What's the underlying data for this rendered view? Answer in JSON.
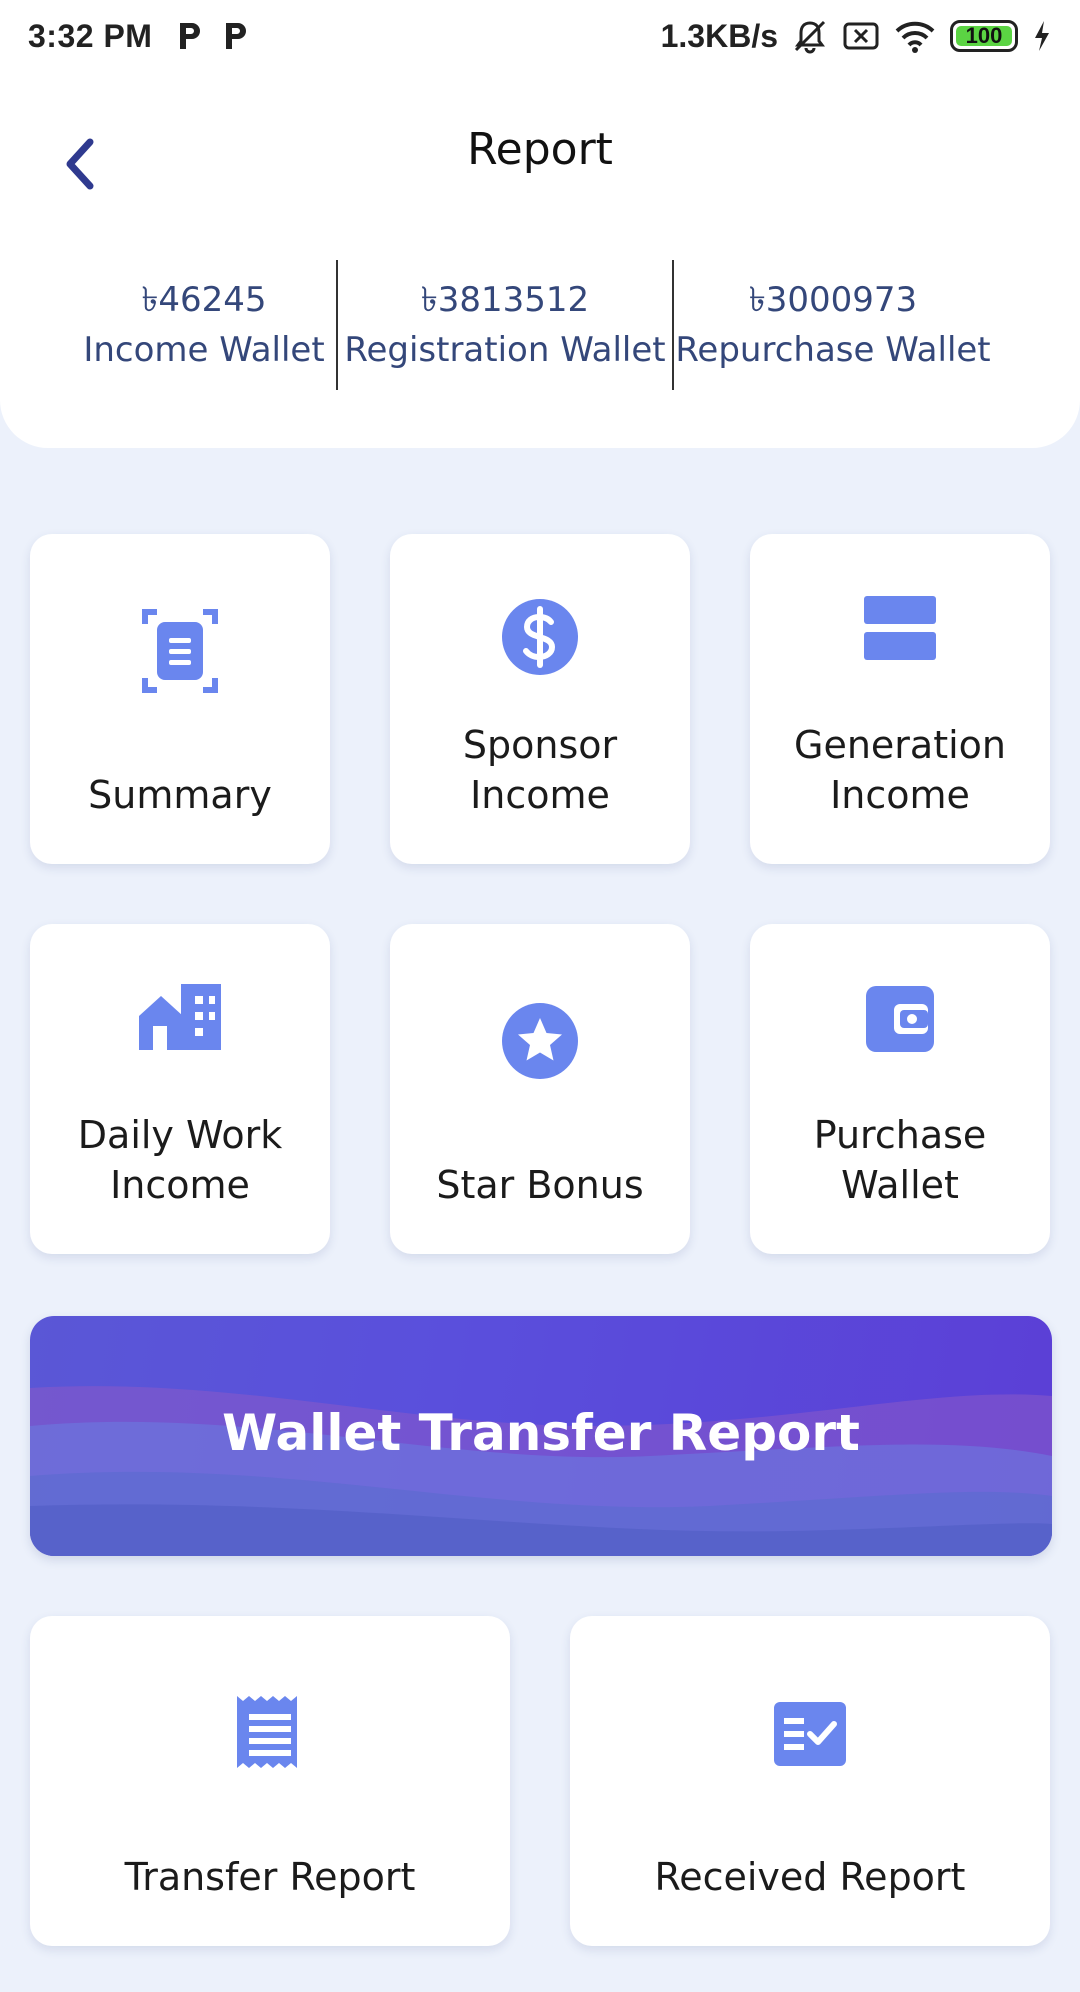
{
  "status_bar": {
    "time": "3:32 PM",
    "net_speed": "1.3KB/s",
    "battery": "100"
  },
  "header": {
    "title": "Report"
  },
  "wallets": [
    {
      "amount": "৳46245",
      "label": "Income Wallet"
    },
    {
      "amount": "৳3813512",
      "label": "Registration Wallet"
    },
    {
      "amount": "৳3000973",
      "label": "Repurchase Wallet"
    }
  ],
  "cards": [
    {
      "label_1": "Summary",
      "label_2": "",
      "icon": "summary-icon"
    },
    {
      "label_1": "Sponsor",
      "label_2": "Income",
      "icon": "dollar-icon"
    },
    {
      "label_1": "Generation",
      "label_2": "Income",
      "icon": "layers-icon"
    },
    {
      "label_1": "Daily Work",
      "label_2": "Income",
      "icon": "building-icon"
    },
    {
      "label_1": "Star Bonus",
      "label_2": "",
      "icon": "star-icon"
    },
    {
      "label_1": "Purchase",
      "label_2": "Wallet",
      "icon": "wallet-icon"
    }
  ],
  "banner": {
    "title": "Wallet Transfer Report"
  },
  "bottom_cards": [
    {
      "label": "Transfer Report",
      "icon": "receipt-icon"
    },
    {
      "label": "Received Report",
      "icon": "checklist-icon"
    }
  ],
  "colors": {
    "accent": "#6a86ee",
    "background": "#ecf1fb",
    "wallet_text": "#34477a",
    "banner": "#5a4fdc"
  }
}
